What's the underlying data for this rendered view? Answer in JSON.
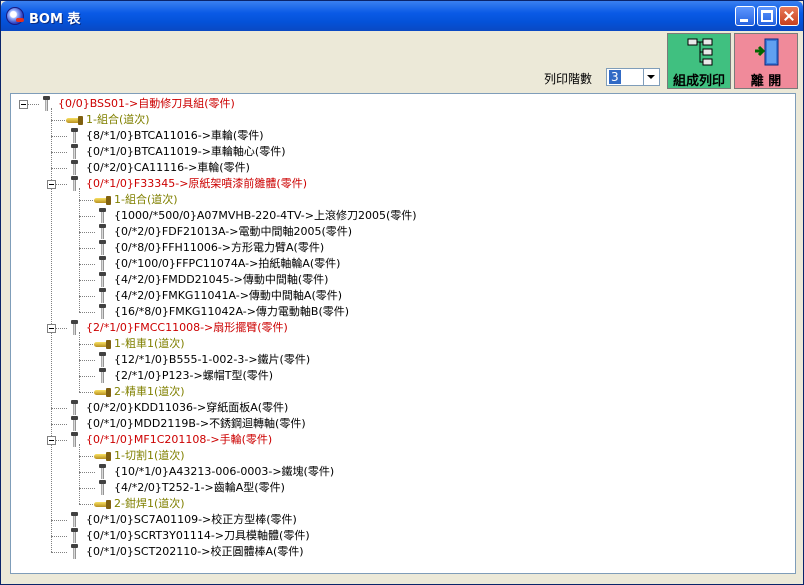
{
  "window": {
    "title": "BOM 表"
  },
  "toolbar": {
    "print_label": "組成列印",
    "exit_label": "離 開",
    "levels_label": "列印階數",
    "levels_value": "3"
  },
  "tree": {
    "nodes": [
      {
        "text": "{0/0}BSS01->自動修刀具組(零件)",
        "type": "asm",
        "level": 0,
        "expanded": true
      },
      {
        "text": "1-組合(道次)",
        "type": "grp",
        "level": 1
      },
      {
        "text": "{8/*1/0}BTCA11016->車輪(零件)",
        "type": "part",
        "level": 1
      },
      {
        "text": "{0/*1/0}BTCA11019->車輪軸心(零件)",
        "type": "part",
        "level": 1
      },
      {
        "text": "{0/*2/0}CA11116->車輪(零件)",
        "type": "part",
        "level": 1
      },
      {
        "text": "{0/*1/0}F33345->原紙架噴漆前雛體(零件)",
        "type": "asm",
        "level": 1,
        "expanded": true
      },
      {
        "text": "1-組合(道次)",
        "type": "grp",
        "level": 2
      },
      {
        "text": "{1000/*500/0}A07MVHB-220-4TV->上滾修刀2005(零件)",
        "type": "part",
        "level": 2
      },
      {
        "text": "{0/*2/0}FDF21013A->電動中間軸2005(零件)",
        "type": "part",
        "level": 2
      },
      {
        "text": "{0/*8/0}FFH11006->方形電力臂A(零件)",
        "type": "part",
        "level": 2
      },
      {
        "text": "{0/*100/0}FFPC11074A->拍紙軸輪A(零件)",
        "type": "part",
        "level": 2
      },
      {
        "text": "{4/*2/0}FMDD21045->傳動中間軸(零件)",
        "type": "part",
        "level": 2
      },
      {
        "text": "{4/*2/0}FMKG11041A->傳動中間軸A(零件)",
        "type": "part",
        "level": 2
      },
      {
        "text": "{16/*8/0}FMKG11042A->傳力電動軸B(零件)",
        "type": "part",
        "level": 2
      },
      {
        "text": "{2/*1/0}FMCC11008->扇形擺臂(零件)",
        "type": "asm",
        "level": 1,
        "expanded": true
      },
      {
        "text": "1-粗車1(道次)",
        "type": "grp",
        "level": 2
      },
      {
        "text": "{12/*1/0}B555-1-002-3->鐵片(零件)",
        "type": "part",
        "level": 2
      },
      {
        "text": "{2/*1/0}P123->螺帽T型(零件)",
        "type": "part",
        "level": 2
      },
      {
        "text": "2-精車1(道次)",
        "type": "grp",
        "level": 2
      },
      {
        "text": "{0/*2/0}KDD11036->穿紙面板A(零件)",
        "type": "part",
        "level": 1
      },
      {
        "text": "{0/*1/0}MDD2119B->不銹鋼迴轉軸(零件)",
        "type": "part",
        "level": 1
      },
      {
        "text": "{0/*1/0}MF1C201108->手輪(零件)",
        "type": "asm",
        "level": 1,
        "expanded": true
      },
      {
        "text": "1-切割1(道次)",
        "type": "grp",
        "level": 2
      },
      {
        "text": "{10/*1/0}A43213-006-0003->鐵塊(零件)",
        "type": "part",
        "level": 2
      },
      {
        "text": "{4/*2/0}T252-1->齒輪A型(零件)",
        "type": "part",
        "level": 2
      },
      {
        "text": "2-鉗焊1(道次)",
        "type": "grp",
        "level": 2
      },
      {
        "text": "{0/*1/0}SC7A01109->校正方型棒(零件)",
        "type": "part",
        "level": 1
      },
      {
        "text": "{0/*1/0}SCRT3Y01114->刀具模軸體(零件)",
        "type": "part",
        "level": 1
      },
      {
        "text": "{0/*1/0}SCT202110->校正圓體棒A(零件)",
        "type": "part",
        "level": 1
      }
    ]
  }
}
